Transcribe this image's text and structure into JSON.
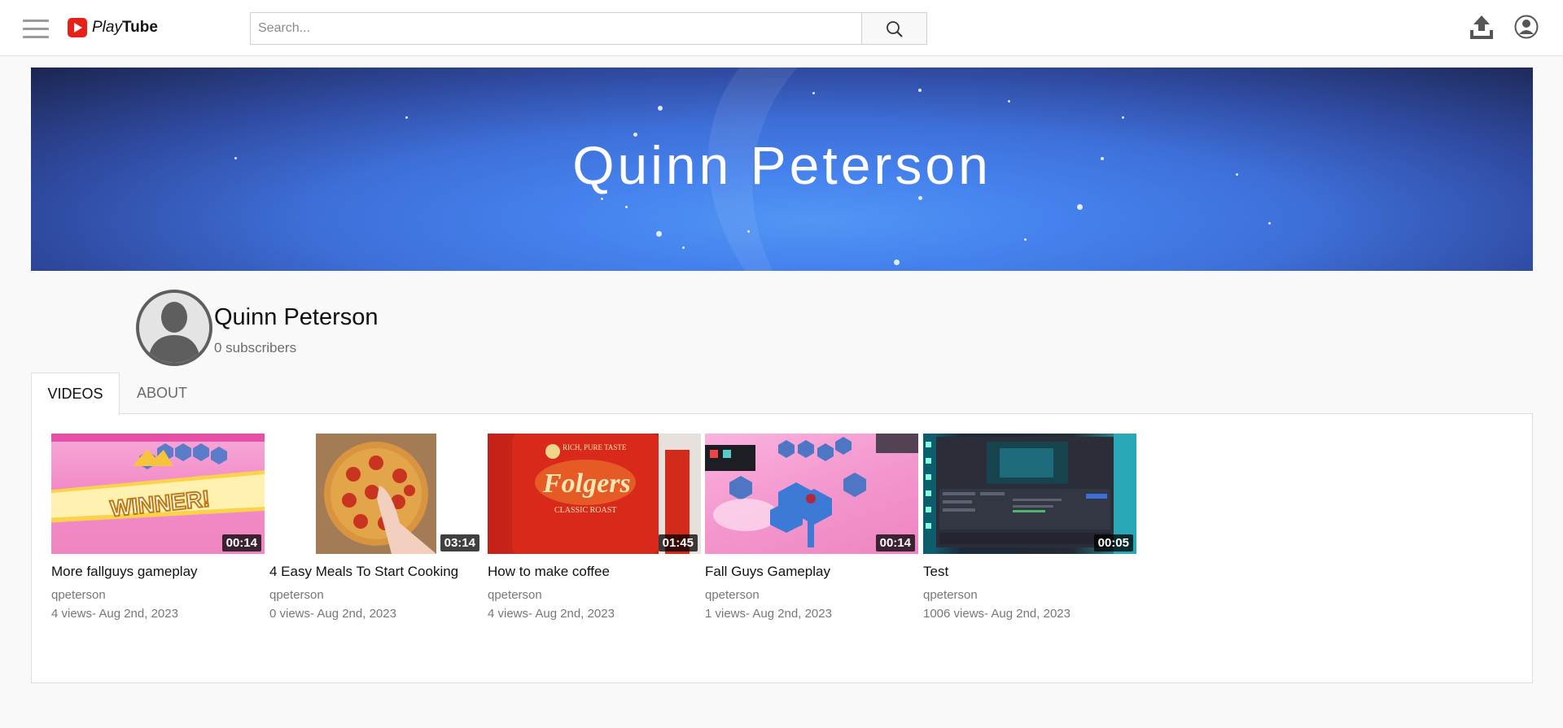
{
  "app": {
    "brand_play": "Play",
    "brand_tube": "Tube"
  },
  "search": {
    "placeholder": "Search..."
  },
  "banner": {
    "title": "Quinn Peterson"
  },
  "channel": {
    "name": "Quinn Peterson",
    "subscribers": "0 subscribers"
  },
  "tabs": [
    {
      "label": "VIDEOS",
      "active": true
    },
    {
      "label": "ABOUT",
      "active": false
    }
  ],
  "videos": [
    {
      "title": "More fallguys gameplay",
      "author": "qpeterson",
      "meta": "4 views- Aug 2nd, 2023",
      "duration": "00:14"
    },
    {
      "title": "4 Easy Meals To Start Cooking",
      "author": "qpeterson",
      "meta": "0 views- Aug 2nd, 2023",
      "duration": "03:14"
    },
    {
      "title": "How to make coffee",
      "author": "qpeterson",
      "meta": "4 views- Aug 2nd, 2023",
      "duration": "01:45"
    },
    {
      "title": "Fall Guys Gameplay",
      "author": "qpeterson",
      "meta": "1 views- Aug 2nd, 2023",
      "duration": "00:14"
    },
    {
      "title": "Test",
      "author": "qpeterson",
      "meta": "1006 views- Aug 2nd, 2023",
      "duration": "00:05"
    }
  ],
  "thumb_text": {
    "winner": "WINNER!",
    "folgers_top": "RICH, PURE TASTE",
    "folgers_brand": "Folgers",
    "folgers_sub": "CLASSIC ROAST"
  },
  "colors": {
    "brand_red": "#e62117",
    "banner_blue": "#4582ee"
  }
}
